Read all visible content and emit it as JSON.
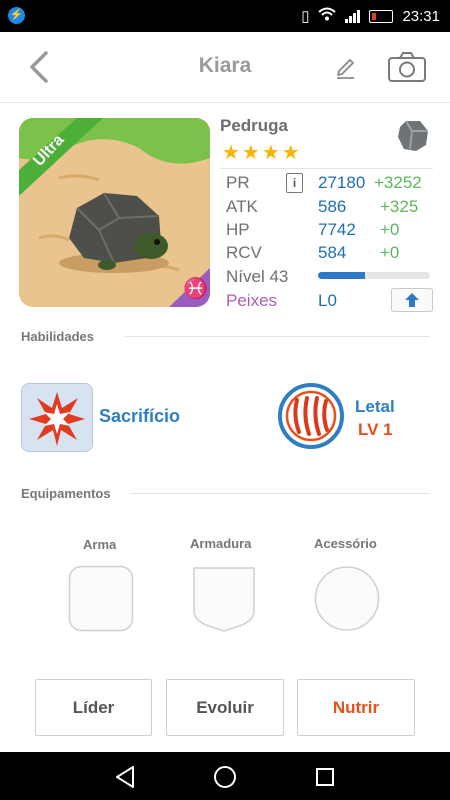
{
  "status": {
    "time": "23:31",
    "icons": [
      "messenger-icon",
      "vibrate-icon",
      "wifi-icon",
      "signal-icon",
      "battery-icon"
    ]
  },
  "header": {
    "title": "Kiara",
    "back_icon": "chevron-left-icon",
    "edit_icon": "pencil-icon",
    "camera_icon": "camera-icon"
  },
  "pet": {
    "badge": "Ultra",
    "name": "Pedruga",
    "stars": "★★★★",
    "star_count": 4,
    "element_icon": "stone-icon",
    "zodiac_icon": "pisces-icon"
  },
  "stats": [
    {
      "label": "PR",
      "value": "27180",
      "plus": "+3252"
    },
    {
      "label": "ATK",
      "value": "586",
      "plus": "+325"
    },
    {
      "label": "HP",
      "value": "7742",
      "plus": "+0"
    },
    {
      "label": "RCV",
      "value": "584",
      "plus": "+0"
    }
  ],
  "level": {
    "label": "Nível 43",
    "progress": 0.42
  },
  "peixes": {
    "label": "Peixes",
    "value": "L0"
  },
  "sections": {
    "habilidades": "Habilidades",
    "equipamentos": "Equipamentos"
  },
  "skills": {
    "main": {
      "name": "Sacrifício",
      "icon": "explosion-icon"
    },
    "secondary": {
      "name": "Letal",
      "level": "LV 1",
      "icon": "claw-icon"
    }
  },
  "equipment": [
    {
      "label": "Arma",
      "shape": "square"
    },
    {
      "label": "Armadura",
      "shape": "shield"
    },
    {
      "label": "Acessório",
      "shape": "circle"
    }
  ],
  "actions": {
    "lider": "Líder",
    "evoluir": "Evoluir",
    "nutrir": "Nutrir"
  },
  "colors": {
    "accent_blue": "#2f7ec4",
    "plus_green": "#5cb85c",
    "accent_orange": "#e8501b",
    "star_yellow": "#f7b500",
    "peixes_purple": "#b05cb0",
    "badge_green": "#4caf3a"
  }
}
